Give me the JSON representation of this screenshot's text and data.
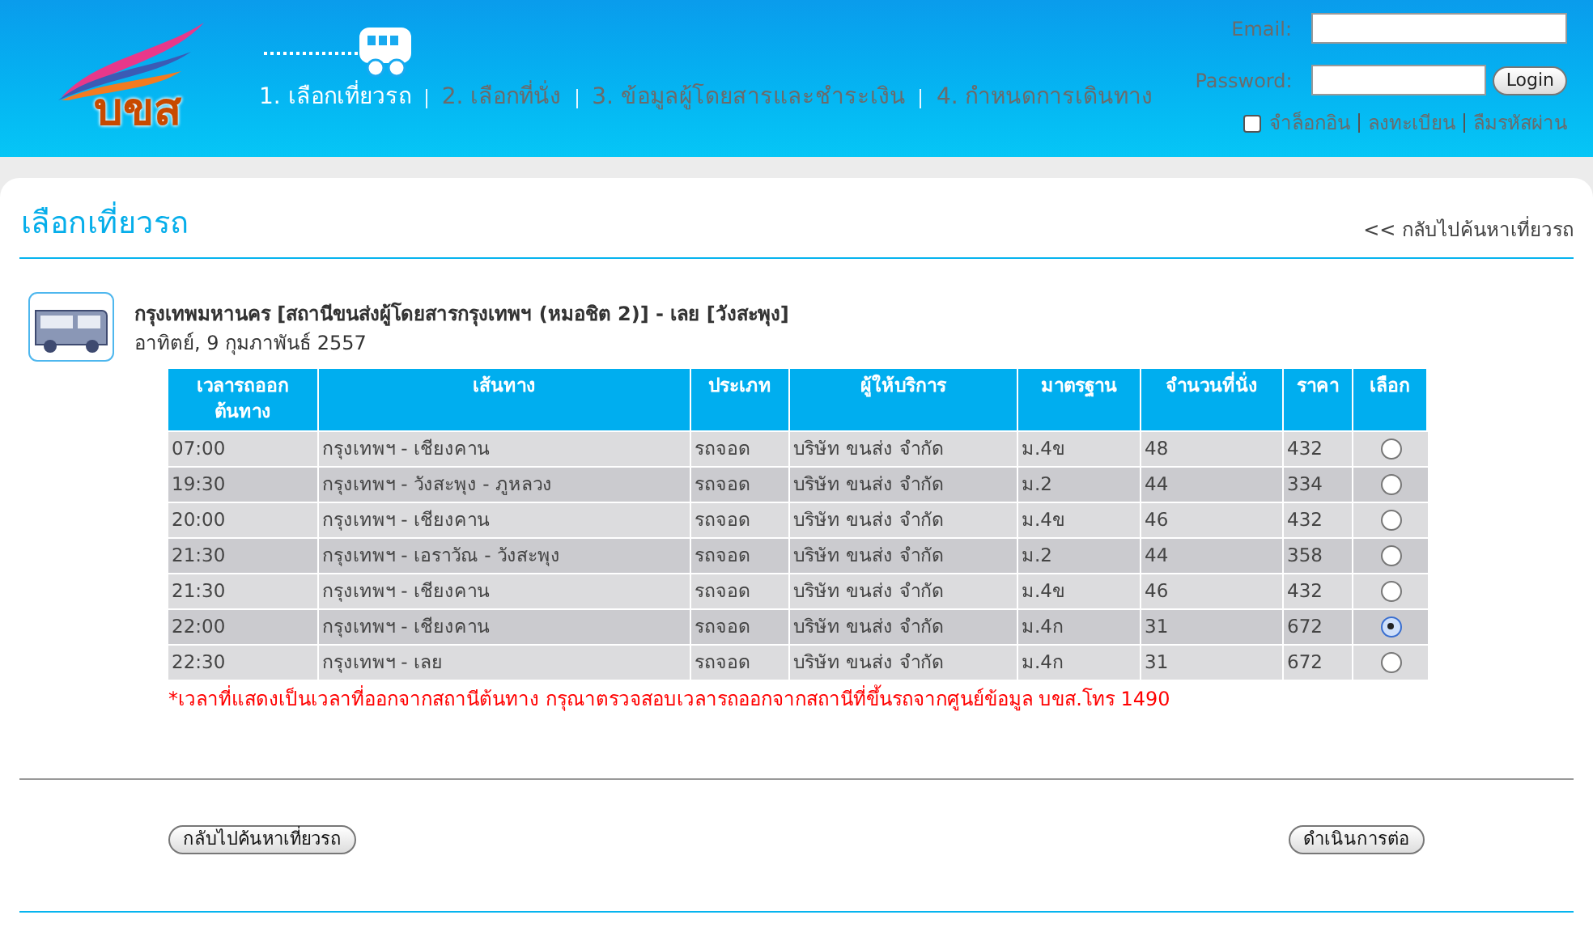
{
  "logo": {
    "text": "บขส"
  },
  "steps": [
    {
      "label": "1. เลือกเที่ยวรถ",
      "selected": true
    },
    {
      "label": "2. เลือกที่นั่ง",
      "selected": false
    },
    {
      "label": "3. ข้อมูลผู้โดยสารและชำระเงิน",
      "selected": false
    },
    {
      "label": "4. กำหนดการเดินทาง",
      "selected": false
    }
  ],
  "login": {
    "email_label": "Email:",
    "password_label": "Password:",
    "button": "Login",
    "remember": {
      "label": "จำล็อกอิน",
      "checked": false
    },
    "links": [
      "ลงทะเบียน",
      "ลืมรหัสผ่าน"
    ]
  },
  "page": {
    "title": "เลือกเที่ยวรถ",
    "back_link": "<< กลับไปค้นหาเที่ยวรถ"
  },
  "trip": {
    "route": "กรุงเทพมหานคร [สถานีขนส่งผู้โดยสารกรุงเทพฯ (หมอชิต 2)] - เลย [วังสะพุง]",
    "date": "อาทิตย์, 9 กุมภาพันธ์ 2557"
  },
  "table": {
    "columns": [
      "เวลารถออกต้นทาง",
      "เส้นทาง",
      "ประเภท",
      "ผู้ให้บริการ",
      "มาตรฐาน",
      "จำนวนที่นั่ง",
      "ราคา",
      "เลือก"
    ],
    "rows": [
      {
        "cells": [
          "07:00",
          "กรุงเทพฯ - เชียงคาน",
          "รถจอด",
          "บริษัท ขนส่ง จำกัด",
          "ม.4ข",
          "48",
          "432"
        ],
        "selected": false
      },
      {
        "cells": [
          "19:30",
          "กรุงเทพฯ - วังสะพุง - ภูหลวง",
          "รถจอด",
          "บริษัท ขนส่ง จำกัด",
          "ม.2",
          "44",
          "334"
        ],
        "selected": false
      },
      {
        "cells": [
          "20:00",
          "กรุงเทพฯ - เชียงคาน",
          "รถจอด",
          "บริษัท ขนส่ง จำกัด",
          "ม.4ข",
          "46",
          "432"
        ],
        "selected": false
      },
      {
        "cells": [
          "21:30",
          "กรุงเทพฯ - เอราวัณ - วังสะพุง",
          "รถจอด",
          "บริษัท ขนส่ง จำกัด",
          "ม.2",
          "44",
          "358"
        ],
        "selected": false
      },
      {
        "cells": [
          "21:30",
          "กรุงเทพฯ - เชียงคาน",
          "รถจอด",
          "บริษัท ขนส่ง จำกัด",
          "ม.4ข",
          "46",
          "432"
        ],
        "selected": false
      },
      {
        "cells": [
          "22:00",
          "กรุงเทพฯ - เชียงคาน",
          "รถจอด",
          "บริษัท ขนส่ง จำกัด",
          "ม.4ก",
          "31",
          "672"
        ],
        "selected": true
      },
      {
        "cells": [
          "22:30",
          "กรุงเทพฯ - เลย",
          "รถจอด",
          "บริษัท ขนส่ง จำกัด",
          "ม.4ก",
          "31",
          "672"
        ],
        "selected": false
      }
    ]
  },
  "note": "*เวลาที่แสดงเป็นเวลาที่ออกจากสถานีต้นทาง กรุณาตรวจสอบเวลารถออกจากสถานีที่ขึ้นรถจากศูนย์ข้อมูล บขส.โทร 1490",
  "buttons": {
    "back": "กลับไปค้นหาเที่ยวรถ",
    "next": "ดำเนินการต่อ"
  }
}
